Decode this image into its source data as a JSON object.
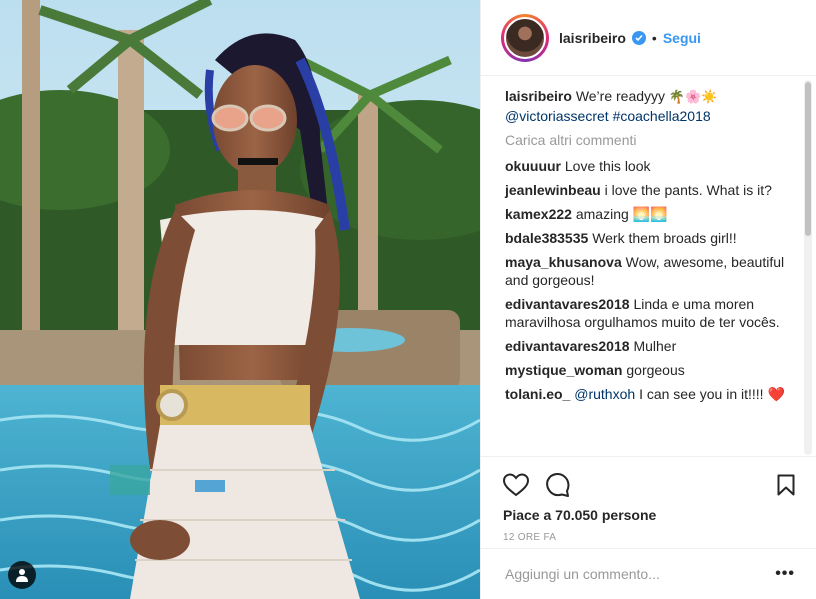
{
  "post": {
    "photo_alt": "photo of a woman posing by a pool with palm trees",
    "tag_icon": "user-tag-icon"
  },
  "header": {
    "username": "laisribeiro",
    "verified_icon": "verified-badge-icon",
    "separator": "•",
    "follow_label": "Segui"
  },
  "caption": {
    "username": "laisribeiro",
    "text": "We’re readyyy",
    "emojis": "🌴🌸☀️",
    "mention": "@victoriassecret",
    "hashtag": "#coachella2018"
  },
  "load_more_label": "Carica altri commenti",
  "comments": [
    {
      "user": "okuuuur",
      "text": "Love this look"
    },
    {
      "user": "jeanlewinbeau",
      "text": "i love the pants. What is it?"
    },
    {
      "user": "kamex222",
      "text": "amazing 🌅🌅"
    },
    {
      "user": "bdale383535",
      "text": "Werk them broads girl!!"
    },
    {
      "user": "maya_khusanova",
      "text": "Wow, awesome, beautiful and gorgeous!"
    },
    {
      "user": "edivantavares2018",
      "text": "Linda e uma moren maravilhosa orgulhamos muito de ter vocês."
    },
    {
      "user": "edivantavares2018",
      "text": "Mulher"
    },
    {
      "user": "mystique_woman",
      "text": "gorgeous"
    },
    {
      "user": "tolani.eo_",
      "mention": "@ruthxoh",
      "text": "I can see you in it!!!! ❤️"
    }
  ],
  "actions": {
    "like_icon": "heart-icon",
    "comment_icon": "comment-bubble-icon",
    "save_icon": "bookmark-icon",
    "likes_text": "Piace a 70.050 persone",
    "time_text": "12 ORE FA"
  },
  "add_comment": {
    "placeholder": "Aggiungi un commento...",
    "more_label": "•••"
  },
  "colors": {
    "accent": "#3897f0",
    "link": "#003569",
    "muted": "#999999",
    "heart": "#ed4956"
  }
}
